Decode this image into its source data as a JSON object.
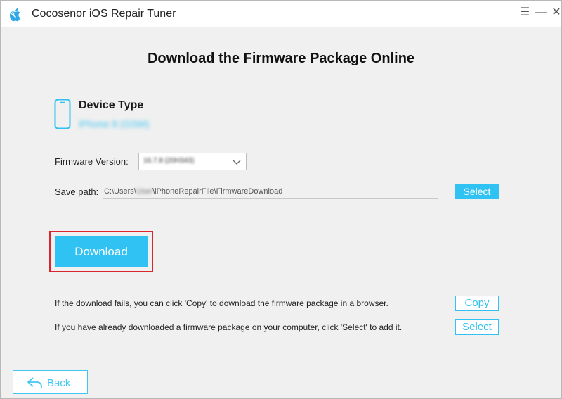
{
  "app": {
    "title": "Cocosenor iOS Repair Tuner",
    "logo_icon": "apple-wrench-icon",
    "accent_color": "#2fc2f2"
  },
  "window_controls": {
    "menu": "☰",
    "minimize": "—",
    "close": "✕"
  },
  "page": {
    "title": "Download the Firmware Package Online"
  },
  "device": {
    "label": "Device Type",
    "value": "iPhone 8 (GSM)",
    "icon": "phone-icon"
  },
  "firmware": {
    "label": "Firmware Version:",
    "selected": "16.7.8 (20H343)"
  },
  "save_path": {
    "label": "Save path:",
    "prefix": "C:\\Users\\",
    "masked_user": "User",
    "suffix": "\\iPhoneRepairFile\\FirmwareDownload",
    "select_label": "Select"
  },
  "download": {
    "label": "Download",
    "highlight_color": "#d9262d"
  },
  "info": {
    "copy_text": "If the download fails, you can click 'Copy' to download the firmware package in a browser.",
    "copy_label": "Copy",
    "select_text": "If you have already downloaded a firmware package on your computer, click 'Select' to add it.",
    "select_label": "Select"
  },
  "footer": {
    "back_label": "Back",
    "back_icon": "back-arrow-icon"
  }
}
